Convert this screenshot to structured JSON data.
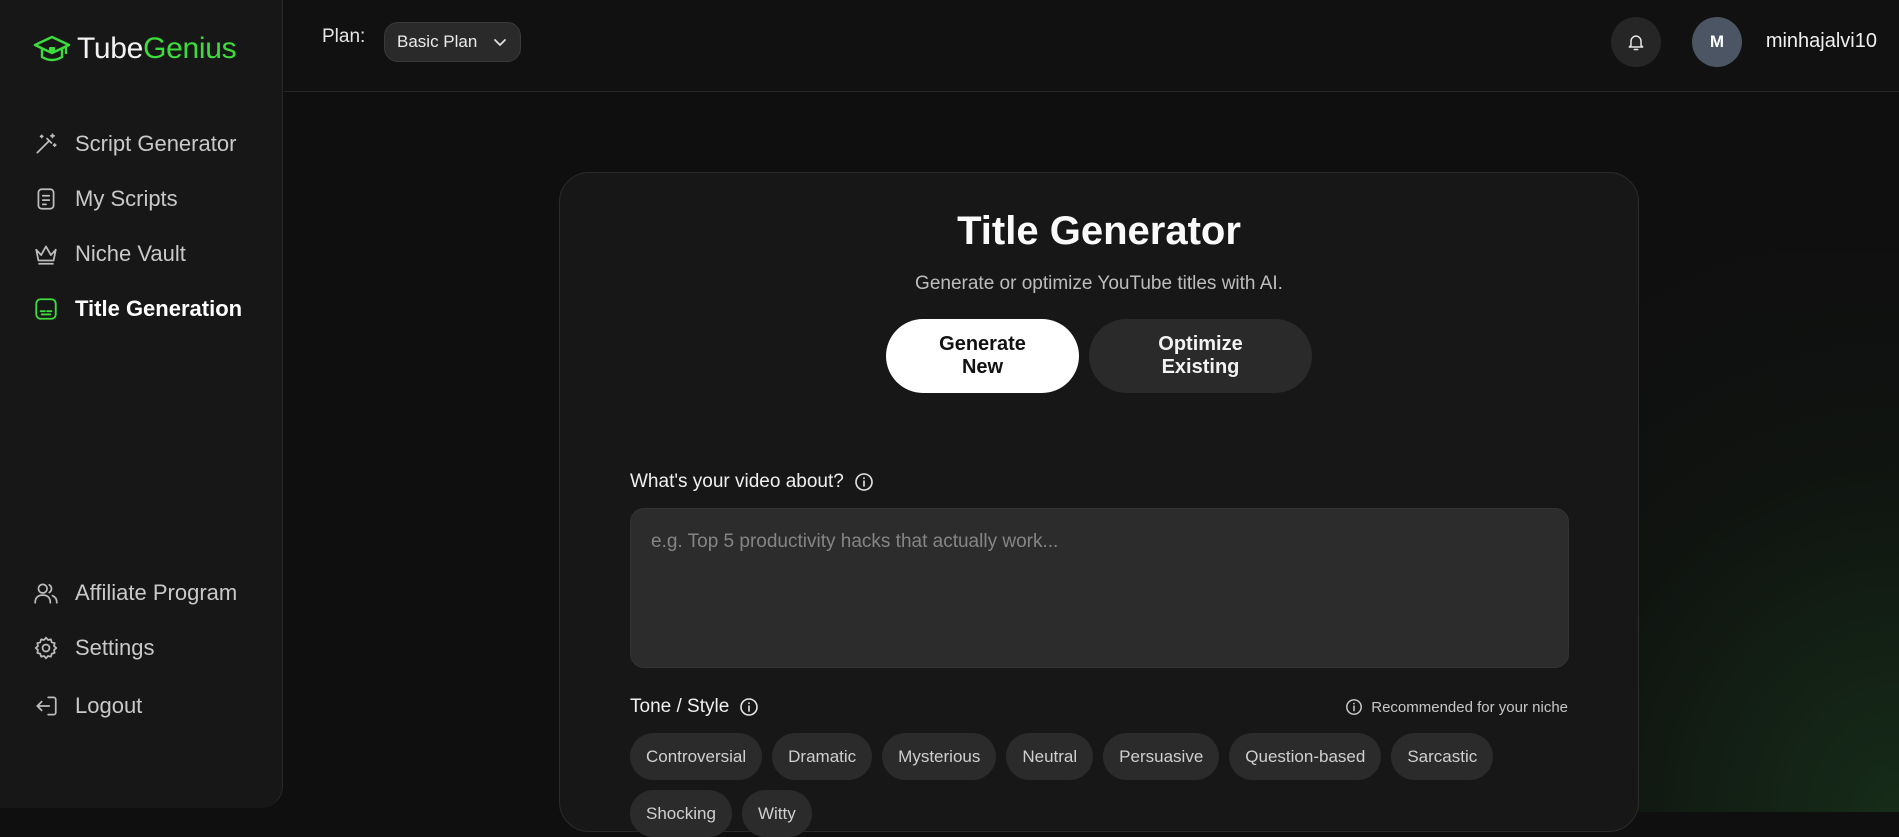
{
  "app": {
    "logo_part1": "Tube",
    "logo_part2": "Genius"
  },
  "sidebar": {
    "top_items": [
      {
        "label": "Script Generator",
        "icon": "magic-wand-icon",
        "active": false
      },
      {
        "label": "My Scripts",
        "icon": "scroll-icon",
        "active": false
      },
      {
        "label": "Niche Vault",
        "icon": "crown-icon",
        "active": false
      },
      {
        "label": "Title Generation",
        "icon": "title-card-icon",
        "active": true
      }
    ],
    "bottom_items": [
      {
        "label": "Affiliate Program",
        "icon": "users-icon"
      },
      {
        "label": "Settings",
        "icon": "gear-icon"
      },
      {
        "label": "Logout",
        "icon": "logout-icon"
      }
    ]
  },
  "header": {
    "plan_label": "Plan:",
    "plan_value": "Basic Plan",
    "avatar_initial": "M",
    "username": "minhajalvi10"
  },
  "main": {
    "title": "Title Generator",
    "subtitle": "Generate or optimize YouTube titles with AI.",
    "btn_generate": "Generate New",
    "btn_optimize": "Optimize Existing",
    "video_label": "What's your video about?",
    "video_placeholder": "e.g. Top 5 productivity hacks that actually work...",
    "tone_label": "Tone / Style",
    "recommended": "Recommended for your niche",
    "tones": [
      "Controversial",
      "Dramatic",
      "Mysterious",
      "Neutral",
      "Persuasive",
      "Question-based",
      "Sarcastic",
      "Shocking",
      "Witty"
    ]
  },
  "colors": {
    "accent": "#3ddc3d",
    "background": "#0f0f0f",
    "card": "#171717"
  }
}
